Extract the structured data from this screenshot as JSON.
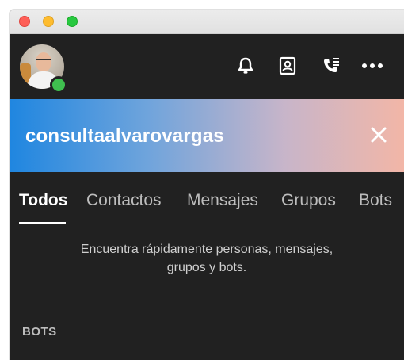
{
  "window": {
    "controls": [
      "close",
      "minimize",
      "zoom"
    ]
  },
  "header": {
    "avatar": {
      "presence": "online",
      "presence_color": "#3fbf4f"
    },
    "icons": [
      "bell-icon",
      "contacts-icon",
      "phone-list-icon",
      "more-icon"
    ]
  },
  "banner": {
    "query": "consultaalvarovargas",
    "gradient": [
      "#1f86e0",
      "#6fa4dc",
      "#c8b5c9",
      "#f2b6a7"
    ]
  },
  "tabs": [
    {
      "label": "Todos",
      "active": true
    },
    {
      "label": "Contactos",
      "active": false
    },
    {
      "label": "Mensajes",
      "active": false
    },
    {
      "label": "Grupos",
      "active": false
    },
    {
      "label": "Bots",
      "active": false
    }
  ],
  "hint": {
    "line1": "Encuentra rápidamente personas, mensajes,",
    "line2": "grupos y bots."
  },
  "section": {
    "label": "BOTS"
  },
  "colors": {
    "background": "#212121",
    "tab_active": "#ffffff",
    "tab_inactive": "#bdbdbd"
  }
}
